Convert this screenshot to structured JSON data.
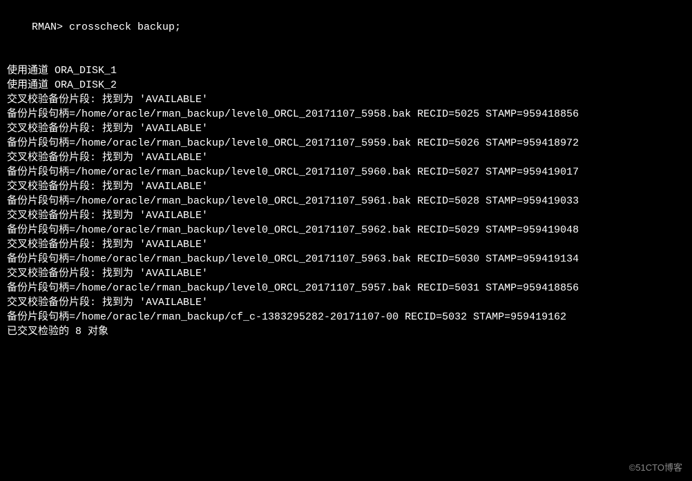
{
  "prompt": "RMAN> ",
  "command": "crosscheck backup;",
  "channels": [
    "使用通道 ORA_DISK_1",
    "使用通道 ORA_DISK_2"
  ],
  "entries": [
    {
      "check_line": "交叉校验备份片段: 找到为 'AVAILABLE'",
      "handle_line": "备份片段句柄=/home/oracle/rman_backup/level0_ORCL_20171107_5958.bak RECID=5025 STAMP=959418856"
    },
    {
      "check_line": "交叉校验备份片段: 找到为 'AVAILABLE'",
      "handle_line": "备份片段句柄=/home/oracle/rman_backup/level0_ORCL_20171107_5959.bak RECID=5026 STAMP=959418972"
    },
    {
      "check_line": "交叉校验备份片段: 找到为 'AVAILABLE'",
      "handle_line": "备份片段句柄=/home/oracle/rman_backup/level0_ORCL_20171107_5960.bak RECID=5027 STAMP=959419017"
    },
    {
      "check_line": "交叉校验备份片段: 找到为 'AVAILABLE'",
      "handle_line": "备份片段句柄=/home/oracle/rman_backup/level0_ORCL_20171107_5961.bak RECID=5028 STAMP=959419033"
    },
    {
      "check_line": "交叉校验备份片段: 找到为 'AVAILABLE'",
      "handle_line": "备份片段句柄=/home/oracle/rman_backup/level0_ORCL_20171107_5962.bak RECID=5029 STAMP=959419048"
    },
    {
      "check_line": "交叉校验备份片段: 找到为 'AVAILABLE'",
      "handle_line": "备份片段句柄=/home/oracle/rman_backup/level0_ORCL_20171107_5963.bak RECID=5030 STAMP=959419134"
    },
    {
      "check_line": "交叉校验备份片段: 找到为 'AVAILABLE'",
      "handle_line": "备份片段句柄=/home/oracle/rman_backup/level0_ORCL_20171107_5957.bak RECID=5031 STAMP=959418856"
    },
    {
      "check_line": "交叉校验备份片段: 找到为 'AVAILABLE'",
      "handle_line": "备份片段句柄=/home/oracle/rman_backup/cf_c-1383295282-20171107-00 RECID=5032 STAMP=959419162"
    }
  ],
  "summary": "已交叉检验的 8 对象",
  "watermark": "©51CTO博客"
}
